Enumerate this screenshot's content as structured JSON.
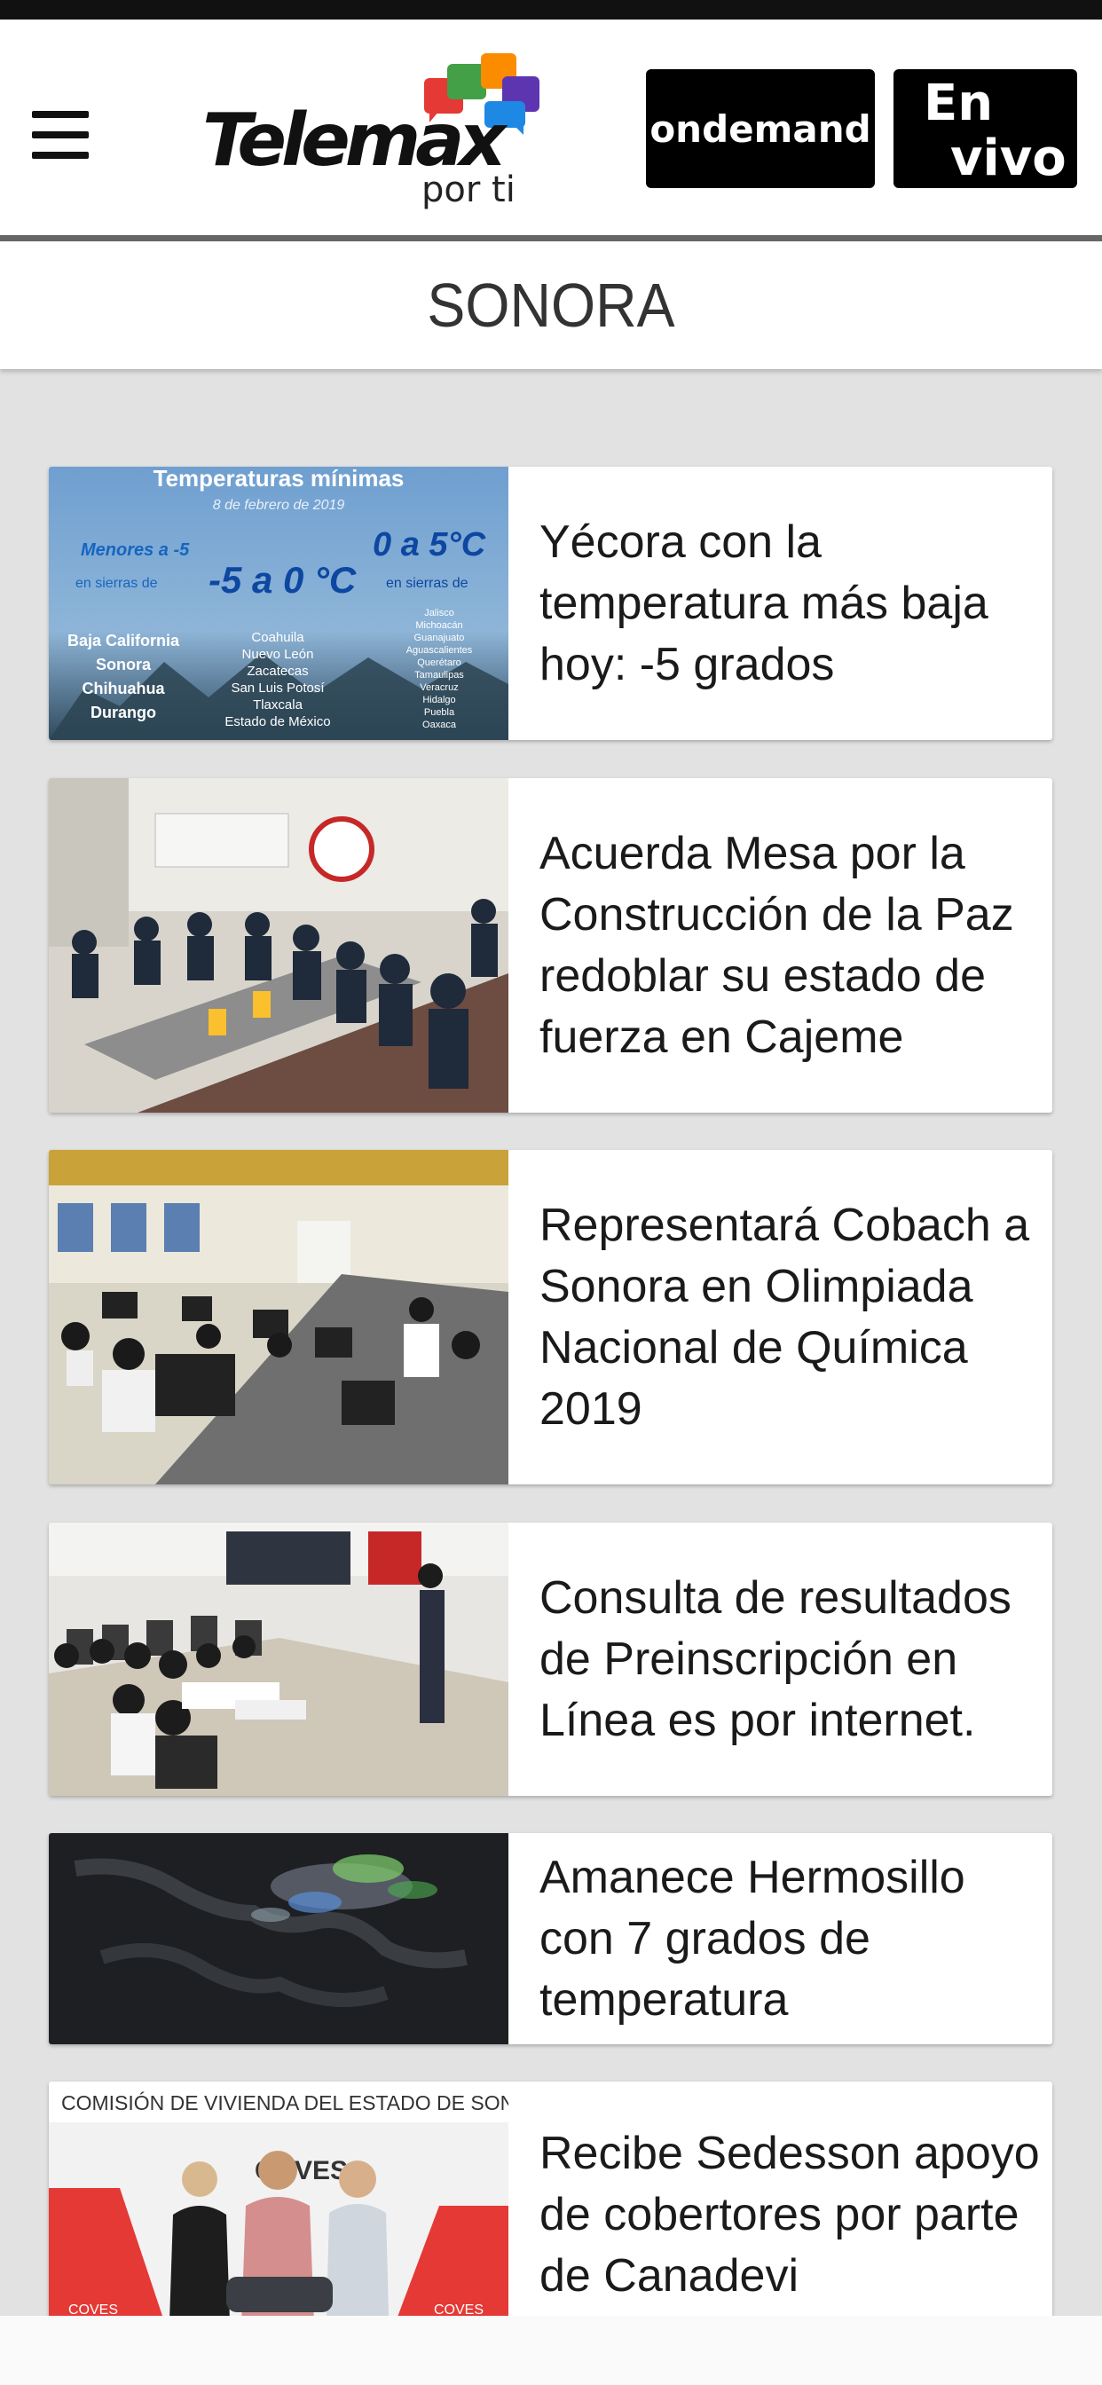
{
  "header": {
    "menu_icon": "hamburger-menu-icon",
    "logo_text": "Telemax",
    "logo_tagline": "por ti",
    "ondemand_label": "ondemand",
    "envivo_label_line1": "En",
    "envivo_label_line2": "vivo"
  },
  "section": {
    "title": "SONORA"
  },
  "articles": [
    {
      "title": "Yécora con la temperatura más baja hoy: -5 grados",
      "thumb_text": {
        "heading": "Temperaturas mínimas",
        "date": "8 de febrero de 2019",
        "left_big": "Menores a -5",
        "left_sub": "en sierras de",
        "left_states": [
          "Baja California",
          "Sonora",
          "Chihuahua",
          "Durango"
        ],
        "mid_big": "-5 a 0 °C",
        "mid_states": [
          "Coahuila",
          "Nuevo León",
          "Zacatecas",
          "San Luis Potosí",
          "Tlaxcala",
          "Estado de México"
        ],
        "right_big": "0 a 5°C",
        "right_sub": "en sierras de",
        "right_states": [
          "Jalisco",
          "Michoacán",
          "Guanajuato",
          "Aguascalientes",
          "Querétaro",
          "Tamaulipas",
          "Veracruz",
          "Hidalgo",
          "Puebla",
          "Oaxaca"
        ]
      }
    },
    {
      "title": "Acuerda Mesa por la Construcción de la Paz redoblar su estado de fuerza en Cajeme"
    },
    {
      "title": "Representará Cobach a Sonora en Olimpiada Nacional de Química 2019"
    },
    {
      "title": "Consulta de resultados de Preinscripción en Línea es por internet."
    },
    {
      "title": "Amanece Hermosillo con 7 grados de temperatura"
    },
    {
      "title": "Recibe Sedesson apoyo de cobertores por parte de Canadevi",
      "thumb_text": {
        "banner": "COMISIÓN DE VIVIENDA DEL ESTADO DE SONORA",
        "brand": "COVES"
      }
    }
  ],
  "colors": {
    "brand_red": "#e53935",
    "brand_green": "#43a047",
    "brand_orange": "#fb8c00",
    "brand_purple": "#5e35b1",
    "brand_blue": "#1e88e5"
  }
}
